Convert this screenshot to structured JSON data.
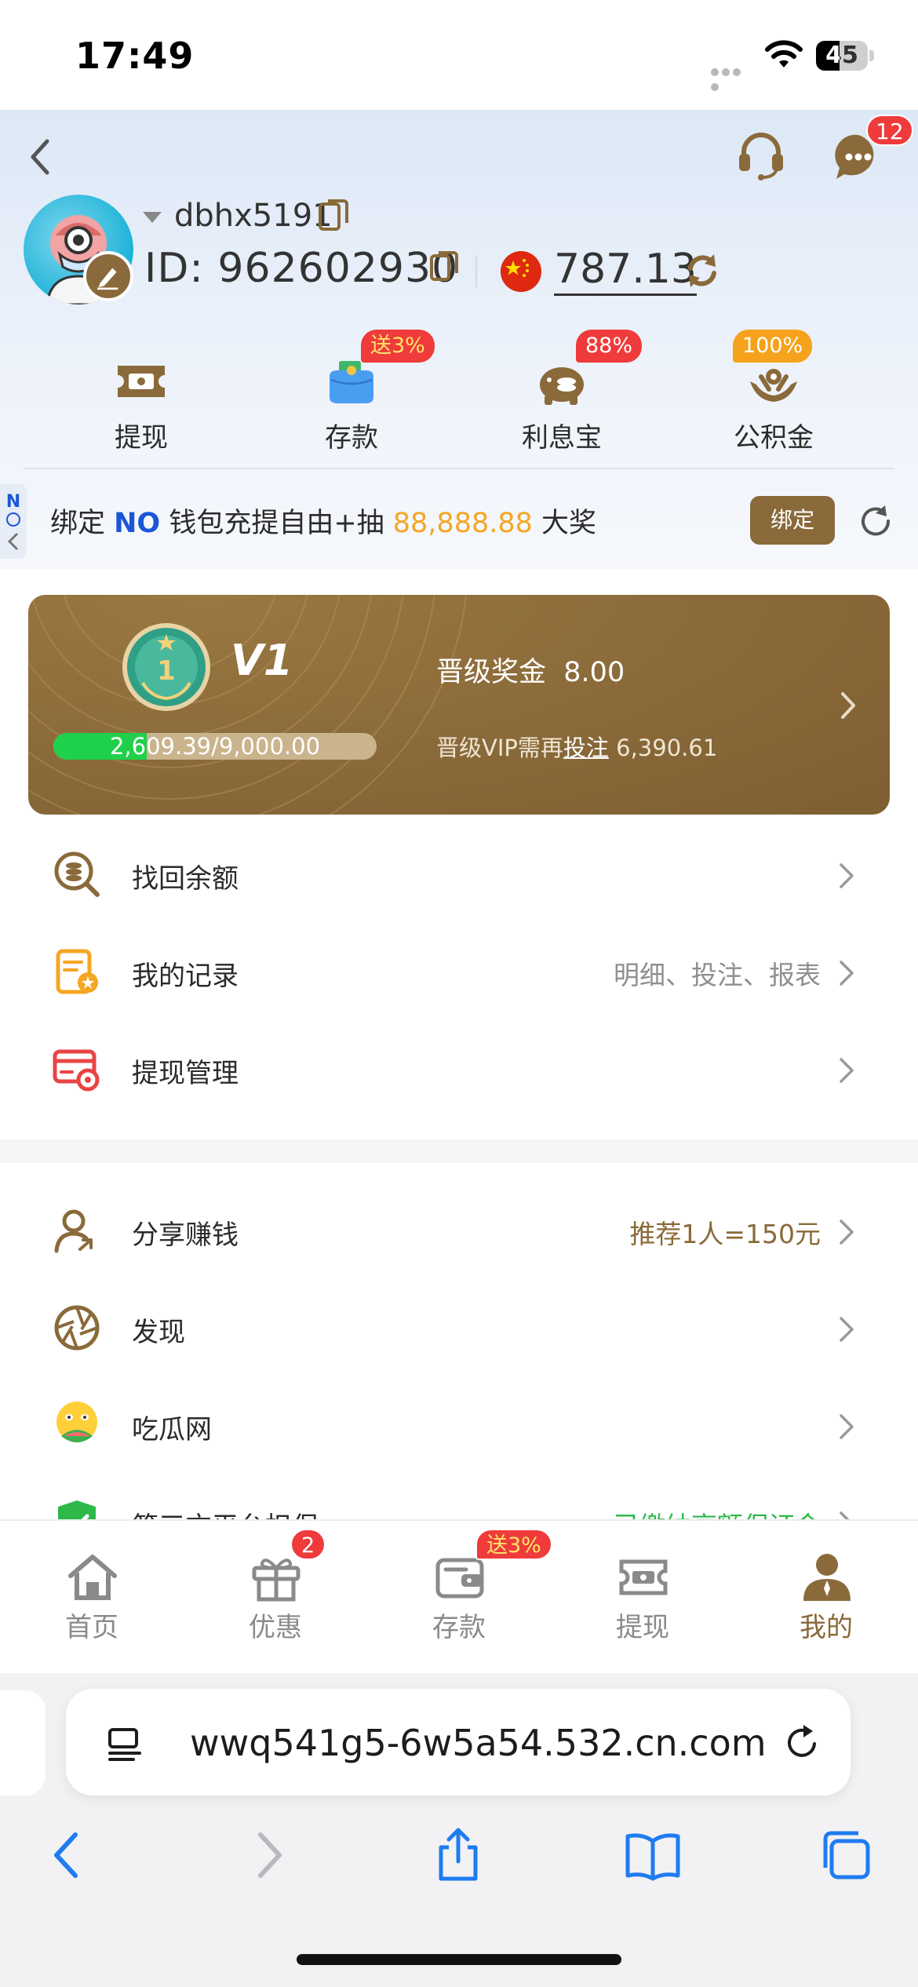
{
  "status_bar": {
    "time": "17:49",
    "battery": "45",
    "battery_level": 0.45
  },
  "header": {
    "message_badge": "12",
    "username": "dbhx5191",
    "id_text": "ID: 962602930",
    "balance": "787.13"
  },
  "quick_actions": [
    {
      "label": "提现",
      "badge": "",
      "icon": "withdraw-ticket-icon"
    },
    {
      "label": "存款",
      "badge": "送3%",
      "icon": "wallet-purse-icon"
    },
    {
      "label": "利息宝",
      "badge": "88%",
      "icon": "piggy-bank-icon"
    },
    {
      "label": "公积金",
      "badge": "100%",
      "icon": "hands-coin-icon"
    }
  ],
  "bind_banner": {
    "prefix": "绑定 ",
    "brand": "NO",
    "middle": " 钱包充提自由+抽 ",
    "amount": "88,888.88",
    "suffix": " 大奖",
    "button": "绑定",
    "side_tab": "N"
  },
  "vip": {
    "level": "V1",
    "medal_number": "1",
    "progress_text": "2,609.39/9,000.00",
    "progress_fraction": 0.29,
    "bonus_label": "晋级奖金",
    "bonus_value": "8.00",
    "requirement_prefix": "晋级VIP需再",
    "requirement_link": "投注",
    "requirement_value": "6,390.61"
  },
  "menu_section_1": [
    {
      "label": "找回余额",
      "hint": ""
    },
    {
      "label": "我的记录",
      "hint": "明细、投注、报表"
    },
    {
      "label": "提现管理",
      "hint": ""
    }
  ],
  "menu_section_2": [
    {
      "label": "分享赚钱",
      "hint": "推荐1人=150元"
    },
    {
      "label": "发现",
      "hint": ""
    },
    {
      "label": "吃瓜网",
      "hint": ""
    },
    {
      "label": "第三方平台担保",
      "hint": "已缴纳高额保证金"
    }
  ],
  "tab_bar": [
    {
      "label": "首页",
      "badge": ""
    },
    {
      "label": "优惠",
      "badge": "2"
    },
    {
      "label": "存款",
      "badge": "送3%"
    },
    {
      "label": "提现",
      "badge": ""
    },
    {
      "label": "我的",
      "badge": ""
    }
  ],
  "browser": {
    "url": "wwq541g5-6w5a54.532.cn.com"
  },
  "colors": {
    "brand_brown": "#8a6a3a",
    "badge_red": "#ef3b3b",
    "progress_green": "#1fd04a",
    "amount_orange": "#f5a623",
    "ios_blue": "#1f7cf0"
  }
}
